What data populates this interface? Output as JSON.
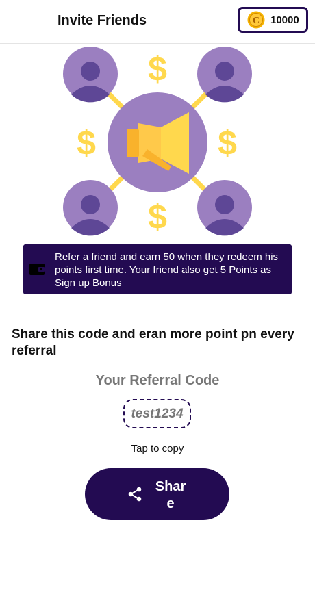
{
  "header": {
    "title": "Invite Friends",
    "coin_balance": "10000",
    "coin_icon": "coin-icon",
    "coin_letter": "C"
  },
  "illustration": {
    "icon": "referral-megaphone-network-illustration"
  },
  "banner": {
    "icon": "wallet-icon",
    "text": "Refer a friend and earn 50 when they redeem his points first time. Your friend also get 5 Points as Sign up Bonus"
  },
  "main": {
    "share_heading": "Share this code and eran more point pn every referral",
    "referral_label": "Your Referral Code",
    "referral_code": "test1234",
    "tap_to_copy": "Tap to copy",
    "share_button_label": "Share",
    "share_icon": "share-icon"
  },
  "colors": {
    "brand": "#230b52",
    "coin": "#f5b300",
    "accent_purple": "#9b7fc0",
    "dollar_yellow": "#ffd84d"
  }
}
